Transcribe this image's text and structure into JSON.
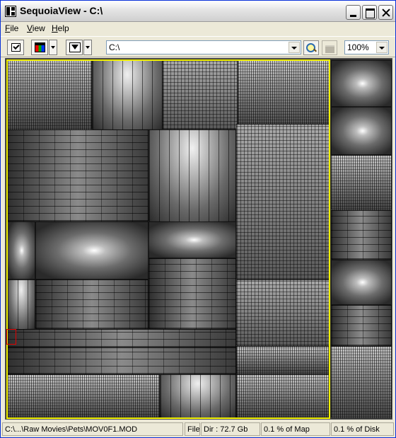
{
  "window": {
    "title": "SequoiaView - C:\\"
  },
  "menu": {
    "items": [
      "File",
      "View",
      "Help"
    ]
  },
  "toolbar": {
    "path": "C:\\",
    "zoom": "100%"
  },
  "status": {
    "path": "C:\\...\\Raw Movies\\Pets\\MOV0F1.MOD",
    "type": "File",
    "dir": "Dir : 72.7 Gb",
    "map_percent": "0.1 % of Map",
    "disk_percent": "0.1 % of Disk"
  },
  "colors": {
    "selection_dir": "#f0f000",
    "selection_file": "#e00000",
    "title_bar": "#e4e4e4"
  }
}
